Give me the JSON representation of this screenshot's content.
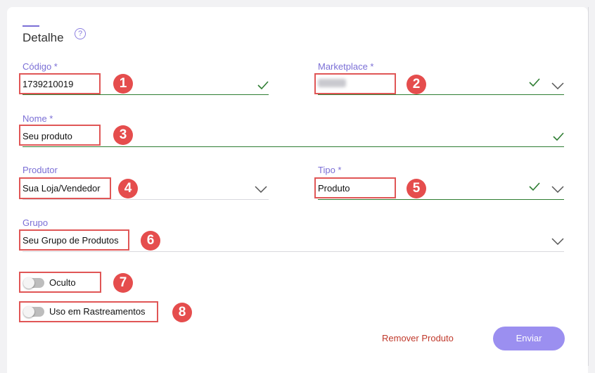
{
  "section": {
    "title": "Detalhe",
    "help_glyph": "?"
  },
  "fields": {
    "codigo": {
      "label": "Código *",
      "value": "1739210019"
    },
    "marketplace": {
      "label": "Marketplace *",
      "value": ""
    },
    "nome": {
      "label": "Nome *",
      "value": "Seu produto"
    },
    "produtor": {
      "label": "Produtor",
      "value": "Sua Loja/Vendedor"
    },
    "tipo": {
      "label": "Tipo *",
      "value": "Produto"
    },
    "grupo": {
      "label": "Grupo",
      "value": "Seu Grupo de Produtos"
    }
  },
  "toggles": {
    "oculto": {
      "label": "Oculto",
      "checked": false
    },
    "rastreamentos": {
      "label": "Uso em Rastreamentos",
      "checked": false
    }
  },
  "actions": {
    "remove_label": "Remover Produto",
    "submit_label": "Enviar"
  },
  "markers": [
    "1",
    "2",
    "3",
    "4",
    "5",
    "6",
    "7",
    "8"
  ],
  "colors": {
    "accent": "#7b6fd6",
    "valid": "#2e7d32",
    "danger": "#c0392b",
    "button": "#9b8ff0",
    "marker": "#e54d4d"
  }
}
